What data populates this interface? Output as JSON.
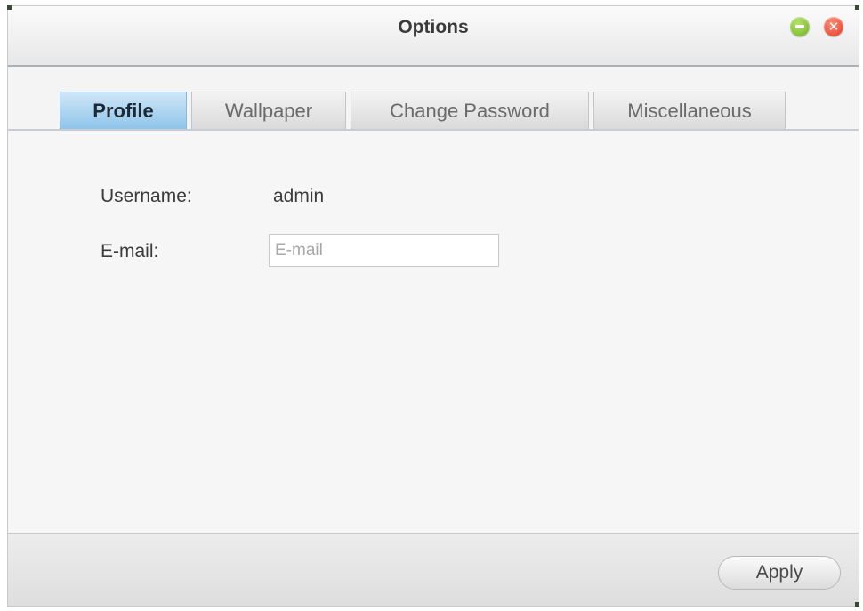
{
  "window": {
    "title": "Options"
  },
  "tabs": [
    {
      "label": "Profile",
      "active": true
    },
    {
      "label": "Wallpaper",
      "active": false
    },
    {
      "label": "Change Password",
      "active": false
    },
    {
      "label": "Miscellaneous",
      "active": false
    }
  ],
  "profile": {
    "username_label": "Username:",
    "username_value": "admin",
    "email_label": "E-mail:",
    "email_value": "",
    "email_placeholder": "E-mail"
  },
  "footer": {
    "apply_label": "Apply"
  },
  "colors": {
    "active_tab": "#8fc4ea",
    "minimize": "#6fae22",
    "close": "#dd3a22"
  },
  "icons": {
    "minimize": "minimize-icon",
    "close": "close-icon"
  }
}
